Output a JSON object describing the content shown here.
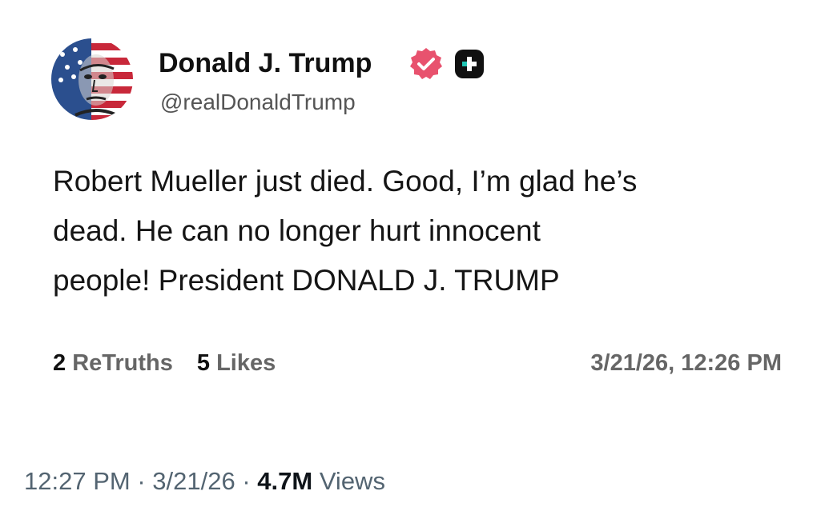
{
  "author": {
    "display_name": "Donald J. Trump",
    "handle": "@realDonaldTrump",
    "verified_icon": "verified-badge-icon",
    "extra_icon": "plus-badge-icon",
    "colors": {
      "verified": "#e8526e",
      "badge": "#111111"
    }
  },
  "post": {
    "lines": [
      "Robert Mueller just died. Good, I’m glad he’s",
      "dead. He can no longer hurt innocent",
      "people! President DONALD J. TRUMP"
    ],
    "retruths_count": "2",
    "retruths_label": "ReTruths",
    "likes_count": "5",
    "likes_label": "Likes",
    "timestamp": "3/21/26, 12:26 PM"
  },
  "footer": {
    "time": "12:27 PM",
    "date": "3/21/26",
    "separator": " · ",
    "views_count": "4.7M",
    "views_label": "Views"
  }
}
